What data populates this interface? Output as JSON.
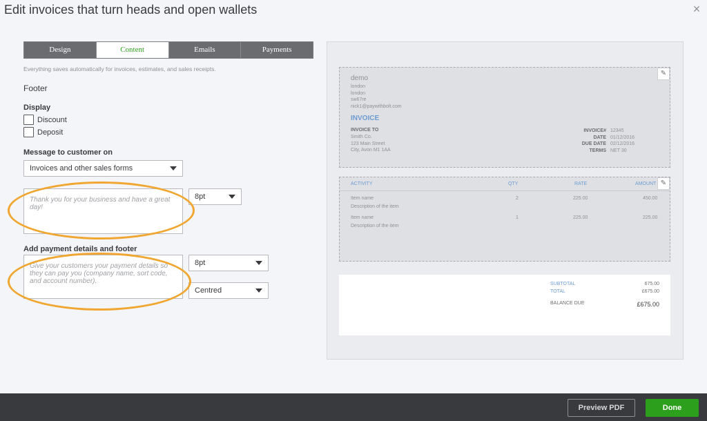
{
  "header": {
    "title": "Edit invoices that turn heads and open wallets",
    "close_glyph": "×"
  },
  "tabs": [
    {
      "label": "Design"
    },
    {
      "label": "Content"
    },
    {
      "label": "Emails"
    },
    {
      "label": "Payments"
    }
  ],
  "active_tab": "Content",
  "autosave_hint": "Everything saves automatically for invoices, estimates, and sales receipts.",
  "form": {
    "section_title": "Footer",
    "display_label": "Display",
    "checkboxes": [
      {
        "label": "Discount",
        "checked": false
      },
      {
        "label": "Deposit",
        "checked": false
      }
    ],
    "message_label": "Message to customer on",
    "message_select": "Invoices and other sales forms",
    "message_placeholder": "Thank you for your business and have a great day!",
    "message_font_size": "8pt",
    "payment_label": "Add payment details and footer",
    "payment_placeholder": "Give your customers your payment details so they can pay you (company name, sort code, and account number).",
    "payment_font_size": "8pt",
    "payment_alignment": "Centred"
  },
  "preview": {
    "company": "demo",
    "address": [
      "london",
      "london",
      "sw67re",
      "nick1@paywithbolt.com"
    ],
    "invoice_title": "INVOICE",
    "invoice_to_label": "INVOICE TO",
    "invoice_to": [
      "Smith Co.",
      "123 Main Street",
      "City, Avon M1 1AA"
    ],
    "meta": [
      {
        "k": "INVOICE#",
        "v": "12345"
      },
      {
        "k": "DATE",
        "v": "01/12/2016"
      },
      {
        "k": "DUE DATE",
        "v": "02/12/2016"
      },
      {
        "k": "TERMS",
        "v": "NET 30"
      }
    ],
    "columns": {
      "activity": "ACTIVITY",
      "qty": "QTY",
      "rate": "RATE",
      "amount": "AMOUNT"
    },
    "items": [
      {
        "name": "Item name",
        "desc": "Description of the item",
        "qty": "2",
        "rate": "225.00",
        "amount": "450.00"
      },
      {
        "name": "Item name",
        "desc": "Description of the item",
        "qty": "1",
        "rate": "225.00",
        "amount": "225.00"
      }
    ],
    "subtotal_label": "SUBTOTAL",
    "subtotal": "675.00",
    "total_label": "TOTAL",
    "total": "£675.00",
    "balance_label": "BALANCE DUE",
    "balance": "£675.00"
  },
  "footer": {
    "preview_pdf": "Preview PDF",
    "done": "Done"
  },
  "colors": {
    "accent_green": "#2ca01c",
    "highlight_orange": "#f0a630",
    "link_blue": "#6c9bd1"
  }
}
